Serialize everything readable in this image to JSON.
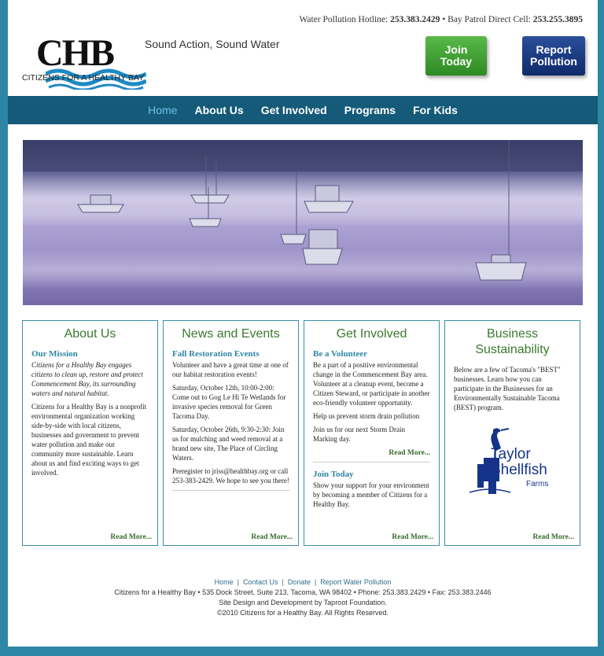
{
  "header": {
    "logo_text": "CHB",
    "logo_subtitle": "CITIZENS FOR A HEALTHY BAY",
    "tagline": "Sound Action, Sound Water",
    "hotline_label": "Water Pollution Hotline:",
    "hotline_number": "253.383.2429",
    "patrol_label": "• Bay Patrol Direct Cell:",
    "patrol_number": "253.255.3895",
    "join_button": "Join Today",
    "report_button": "Report Pollution"
  },
  "nav": {
    "items": [
      {
        "label": "Home",
        "active": true
      },
      {
        "label": "About Us",
        "active": false
      },
      {
        "label": "Get Involved",
        "active": false
      },
      {
        "label": "Programs",
        "active": false
      },
      {
        "label": "For Kids",
        "active": false
      }
    ]
  },
  "boxes": {
    "about": {
      "title": "About Us",
      "subtitle": "Our Mission",
      "mission": "Citizens for a Healthy Bay engages citizens to clean up, restore and protect Commencement Bay, its surrounding waters and natural habitat.",
      "body": "Citizens for a Healthy Bay is a nonprofit environmental organization working side-by-side with local citizens, businesses and government to prevent water pollution and make our community more sustainable. Learn about us and find exciting ways to get involved.",
      "read_more": "Read More..."
    },
    "news": {
      "title": "News and Events",
      "subtitle": "Fall Restoration Events",
      "p1": "Volunteer and have a great time at one of our habitat restoration events!",
      "p2": "Saturday, October 12th, 10:00-2:00: Come out to Gog Le Hi Te Wetlands for invasive species removal for Green Tacoma Day.",
      "p3": "Saturday, October 26th, 9:30-2:30: Join us for mulching and weed removal at a brand new site, The Place of Circling Waters.",
      "p4": "Preregister to jriss@healthbay.org or call 253-383-2429. We hope to see you there!",
      "read_more": "Read More..."
    },
    "involved": {
      "title": "Get Involved",
      "subtitle1": "Be a Volunteer",
      "p1": "Be a part of a positive environmental change in the Commencement Bay area. Volunteer at a cleanup event, become a Citizen Steward, or participate in another eco-friendly volunteer opportunity.",
      "p2": "Help us prevent storm drain pollution",
      "p3": "Join us for our next Storm Drain Marking day.",
      "read_more_1": "Read More...",
      "subtitle2": "Join Today",
      "p4": "Show your support for your environment by becoming a member of Citizens for a Healthy Bay.",
      "read_more_2": "Read More..."
    },
    "business": {
      "title": "Business Sustainability",
      "body": "Below are a few of Tacoma's \"BEST\" businesses. Learn how you can participate in the Businesses for an Environmentally Sustainable Tacoma (BEST) program.",
      "logo_line1": "Taylor",
      "logo_line2": "Shellfish",
      "logo_line3": "Farms",
      "read_more": "Read More..."
    }
  },
  "footer": {
    "links": [
      "Home",
      "Contact Us",
      "Donate",
      "Report Water Pollution"
    ],
    "address": "Citizens for a Healthy Bay • 535 Dock Street, Suite 213, Tacoma, WA 98402 • Phone: 253.383.2429 • Fax: 253.383.2446",
    "credit": "Site Design and Development by Taproot Foundation.",
    "copyright": "©2010 Citizens for a Healthy Bay. All Rights Reserved."
  },
  "colors": {
    "background": "#2e86a6",
    "nav": "#155a78",
    "heading_green": "#3a7a2e",
    "link_blue": "#2e86a6",
    "join_green": "#3a9e2f",
    "report_navy": "#0e2a6a"
  }
}
